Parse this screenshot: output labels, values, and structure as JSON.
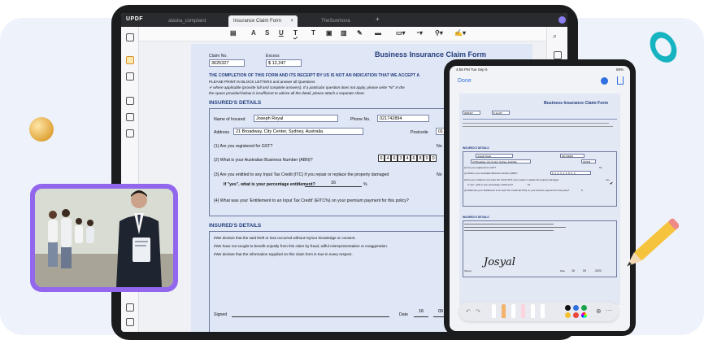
{
  "app": {
    "logo": "UPDF",
    "tabs": [
      "alaska_complaint",
      "Insurance Claim Form",
      "TheSunmova"
    ],
    "active_tab": 1,
    "close_glyph": "×",
    "new_tab_glyph": "+"
  },
  "form": {
    "title": "Business Insurance Claim Form",
    "claim_label": "Claim No.",
    "claim_value": "3625327",
    "excess_label": "Excess",
    "excess_value": "$ 12,247",
    "warning": "THE COMPLETION OF THIS FORM AND ITS RECEIPT BY US IS NOT AN INDICATION THAT WE ACCEPT A",
    "instruction1": "PLEASE PRINT IN BLOCK LETTERS and answer all Questions",
    "instruction2": "where applicable (provide full and complete answers). If a particular question does not apply, please write \"N/\" in the",
    "instruction3": "the space provided below is insufficient to advise all the detail, please attach a separate sheet.",
    "section_insured": "INSURED'S DETAILS",
    "name_label": "Name of Insured",
    "name_value": "Joseph Royal",
    "phone_label": "Phone No.",
    "phone_value": "021742894",
    "address_label": "Address",
    "address_value": "21 Broadway, City Center, Sydney, Australia.",
    "postcode_label": "Postcode",
    "postcode_value": "01",
    "q1": "(1) Are you registered for GST?",
    "q1_answer": "No",
    "q2": "(2) What is your Australian Business Number (ABN)?",
    "abn": [
      "6",
      "4",
      "6",
      "3",
      "4",
      "6",
      "8",
      "9",
      "0"
    ],
    "q3": "(3) Are you entitled to any Input Tax Credit (ITC) if you repair or replace the property damaged",
    "q3_answer": "No",
    "q3b": "If \"yes\", what is your percentage entitlement?",
    "q3b_value": "16",
    "percent": "%",
    "q4": "(4) What was your 'Entitlement to an Input Tax Credit' (EITC%) on your premium payment for this policy?",
    "section_decl": "INSURED'S DETAILS",
    "decl1": "I/We declare that the said theft or loss occurred without my/our knowledge or consent.",
    "decl2": "I/We have not sought to benefit unjustly from this claim by fraud, wilful misrepresentation or exaggeration.",
    "decl3": "I/We declare that the information supplied on this claim form is true in every respect.",
    "signed_label": "Signed",
    "date_label": "Date",
    "date_day": "16",
    "date_month": "09"
  },
  "ipad": {
    "time": "4:56 PM  Tue Sep 6",
    "battery": "88%",
    "done": "Done",
    "title": "Business Insurance Claim Form",
    "claim_value": "3625327",
    "excess_value": "$ 12,247",
    "name_value": "Joseph Royal",
    "phone_value": "021742894",
    "address_value": "21 Broadway, City Center, Sydney, Australia.",
    "postcode_value": "022234",
    "abn": [
      "6",
      "4",
      "6",
      "3",
      "4",
      "6",
      "8",
      "9",
      "0"
    ],
    "pct": "16",
    "eitc": "8",
    "section1": "INSURED'S DETAILS",
    "section2": "INSURED'S DETAILS",
    "signed_label": "Signed",
    "date_label": "Date",
    "date_day": "16",
    "date_month": "09",
    "date_year": "2022",
    "signature": "Josyal",
    "q1": "(1) Are you registered for GST?",
    "q2": "(2) What is your Australian Business Number (ABN)?",
    "q3": "(3) Are you entitled to any Input Tax Credit (ITC) if you repair or replace the property damaged",
    "q3b": "If \"yes\", what is your percentage entitlement?",
    "q4": "(4) What was your 'Entitlement to an Input Tax Credit' (EITC%) on your premium payment for this policy?",
    "no": "No",
    "yes": "Yes",
    "colors": [
      "#111111",
      "#2f6fe0",
      "#1ba34a",
      "#f2c12e",
      "#e8463d",
      "#7b4ce0"
    ]
  }
}
